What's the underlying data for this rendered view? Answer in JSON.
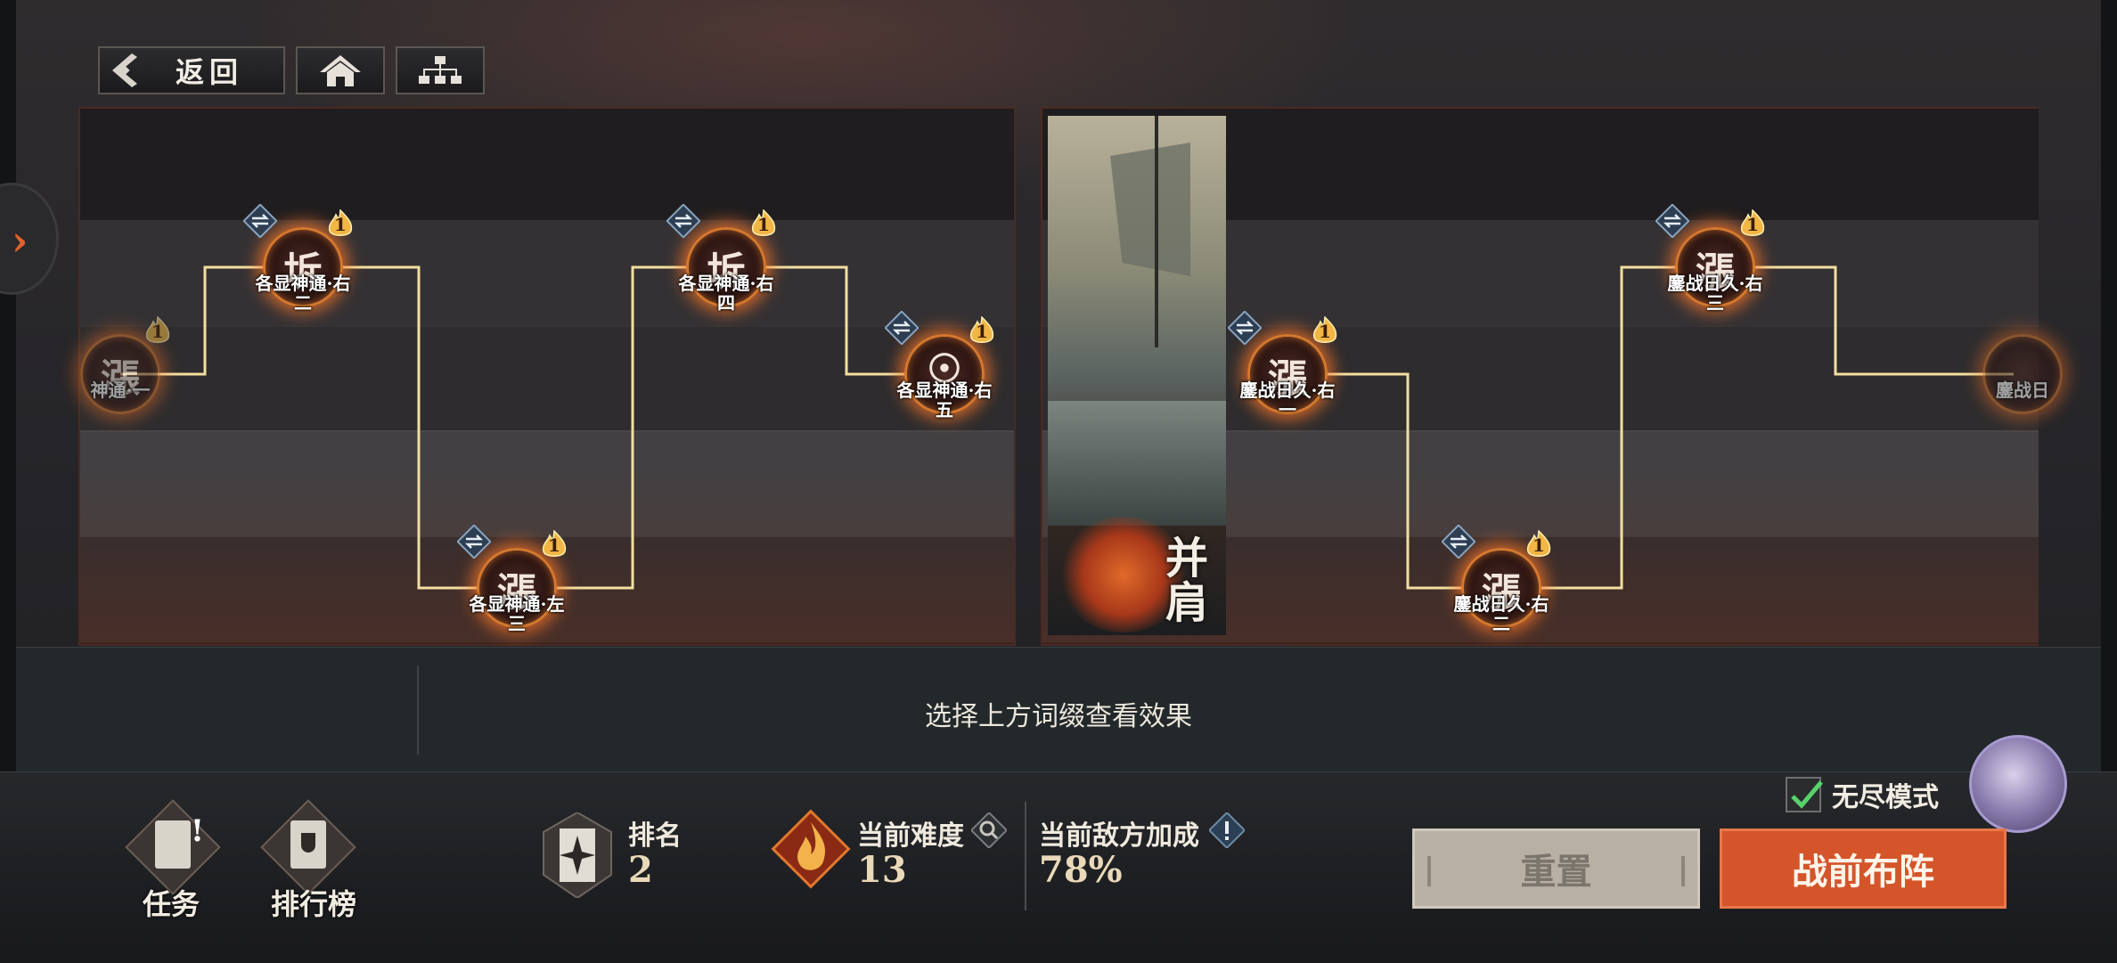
{
  "nav": {
    "back_label": "返回",
    "home_icon": "home-icon",
    "map_icon": "tree-structure-icon"
  },
  "painting": {
    "title": "并肩"
  },
  "left_nodes": [
    {
      "caption_lines": [
        "神通·一"
      ],
      "glyph": "漲",
      "level": "1",
      "faded": true
    },
    {
      "caption_lines": [
        "各显神通·右",
        "二"
      ],
      "glyph": "坼",
      "level": "1"
    },
    {
      "caption_lines": [
        "各显神通·左",
        "三"
      ],
      "glyph": "漲",
      "level": "1"
    },
    {
      "caption_lines": [
        "各显神通·右",
        "四"
      ],
      "glyph": "坼",
      "level": "1"
    },
    {
      "caption_lines": [
        "各显神通·右",
        "五"
      ],
      "glyph": "☉",
      "level": "1"
    }
  ],
  "right_nodes": [
    {
      "caption_lines": [
        "鏖战日久·右",
        "一"
      ],
      "glyph": "漲",
      "level": "1"
    },
    {
      "caption_lines": [
        "鏖战日久·右",
        "二"
      ],
      "glyph": "漲",
      "level": "1"
    },
    {
      "caption_lines": [
        "鏖战日久·右",
        "三"
      ],
      "glyph": "漲",
      "level": "1"
    },
    {
      "caption_lines": [
        "鏖战日"
      ],
      "glyph": "",
      "level": "",
      "faded": true
    }
  ],
  "description": {
    "hint": "选择上方词缀查看效果"
  },
  "bottom": {
    "task_label": "任务",
    "ranking_label": "排行榜",
    "rank_title": "排名",
    "rank_value": "2",
    "difficulty_title": "当前难度",
    "difficulty_value": "13",
    "enemy_bonus_title": "当前敌方加成",
    "enemy_bonus_value": "78%",
    "endless_label": "无尽模式",
    "endless_checked": true,
    "reset_label": "重置",
    "deploy_label": "战前布阵"
  },
  "colors": {
    "accent": "#d4552a",
    "path_line": "#f2dfa0",
    "glow": "#ff8a3c"
  }
}
